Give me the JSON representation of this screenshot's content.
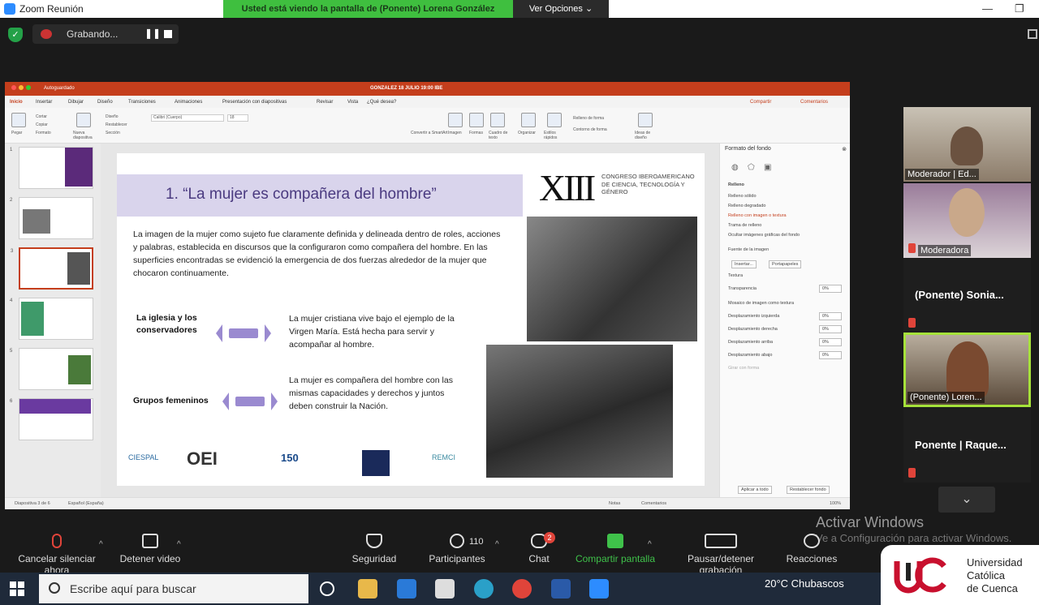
{
  "window": {
    "title": "Zoom Reunión"
  },
  "share_banner": "Usted está viendo la pantalla de (Ponente) Lorena González",
  "view_options": "Ver Opciones",
  "recording": {
    "label": "Grabando..."
  },
  "ppt": {
    "autosave": "Autoguardado",
    "doc_title": "GONZALEZ 18 JULIO 19:00 IBE",
    "tabs": [
      "Inicio",
      "Insertar",
      "Dibujar",
      "Diseño",
      "Transiciones",
      "Animaciones",
      "Presentación con diapositivas",
      "Revisar",
      "Vista",
      "¿Qué desea?"
    ],
    "share": "Compartir",
    "comments": "Comentarios",
    "ribbon": {
      "paste": "Pegar",
      "cut": "Cortar",
      "copy": "Copiar",
      "format": "Formato",
      "new_slide": "Nueva diapositiva",
      "design": "Diseño",
      "reset": "Restablecer",
      "section": "Sección",
      "font": "Calibri (Cuerpo)",
      "size": "18",
      "image": "Imagen",
      "shapes": "Formas",
      "textbox": "Cuadro de texto",
      "organize": "Organizar",
      "quick_styles": "Estilos rápidos",
      "fill": "Relleno de forma",
      "outline": "Contorno de forma",
      "convert": "Convertir a SmartArt",
      "ideas": "Ideas de diseño"
    },
    "thumb_numbers": [
      "1",
      "2",
      "3",
      "4",
      "5",
      "6"
    ],
    "status_left": "Diapositiva 3 de 6",
    "status_lang": "Español (España)",
    "status_notes": "Notas",
    "status_comments": "Comentarios",
    "status_zoom": "100%"
  },
  "slide": {
    "title": "1. “La mujer es compañera del hombre”",
    "paragraph": "La imagen de la mujer como sujeto fue claramente definida y delineada dentro de roles, acciones y palabras, establecida en discursos que la configuraron como compañera del hombre. En las superficies encontradas se evidenció la emergencia de dos fuerzas alrededor de la mujer que chocaron continuamente.",
    "xiii": "XIII",
    "congreso": "CONGRESO IBEROAMERICANO DE CIENCIA, TECNOLOGÍA Y GÉNERO",
    "row1_label": "La iglesia y los conservadores",
    "row1_text": "La mujer cristiana vive bajo el ejemplo de la Virgen María. Está hecha para servir y acompañar al hombre.",
    "row2_label": "Grupos femeninos",
    "row2_text": "La mujer es compañera del hombre con las mismas capacidades y derechos y juntos deben construir la Nación.",
    "logos": [
      "CIESPAL",
      "OEI",
      "150",
      "REMCI"
    ]
  },
  "format_pane": {
    "title": "Formato del fondo",
    "section": "Relleno",
    "options": [
      "Relleno sólido",
      "Relleno degradado",
      "Relleno con imagen o textura",
      "Trama de relleno",
      "Ocultar imágenes gráficas del fondo"
    ],
    "source": "Fuente de la imagen",
    "insert": "Insertar...",
    "clipboard": "Portapapeles",
    "texture": "Textura",
    "transparency": "Transparencia",
    "transparency_val": "0%",
    "tile": "Mosaico de imagen como textura",
    "offsets": [
      "Desplazamiento izquierda",
      "Desplazamiento derecha",
      "Desplazamiento arriba",
      "Desplazamiento abajo"
    ],
    "offset_val": "0%",
    "rotate": "Girar con forma",
    "apply_all": "Aplicar a todo",
    "reset_bg": "Restablecer fondo"
  },
  "participants": [
    {
      "name": "Moderador | Ed...",
      "type": "video"
    },
    {
      "name": "Moderadora",
      "type": "video"
    },
    {
      "name": "(Ponente)  Sonia...",
      "type": "name"
    },
    {
      "name": "(Ponente) Loren...",
      "type": "video"
    },
    {
      "name": "Ponente | Raque...",
      "type": "name"
    }
  ],
  "watermark": {
    "line1": "Activar Windows",
    "line2": "Ve a Configuración para activar Windows."
  },
  "toolbar": {
    "mute": "Cancelar silenciar ahora",
    "video": "Detener video",
    "security": "Seguridad",
    "participants": "Participantes",
    "participants_count": "110",
    "chat": "Chat",
    "chat_badge": "2",
    "share": "Compartir pantalla",
    "record": "Pausar/detener grabación",
    "reactions": "Reacciones"
  },
  "taskbar": {
    "search": "Escribe aquí para buscar",
    "weather": "20°C  Chubascos"
  },
  "university": {
    "line1": "Universidad",
    "line2": "Católica",
    "line3": "de Cuenca"
  },
  "colors": {
    "share_green": "#3fbf3f",
    "ppt_red": "#c43e1c",
    "slide_purple": "#4a3a80",
    "active_tile": "#a6e23a"
  }
}
